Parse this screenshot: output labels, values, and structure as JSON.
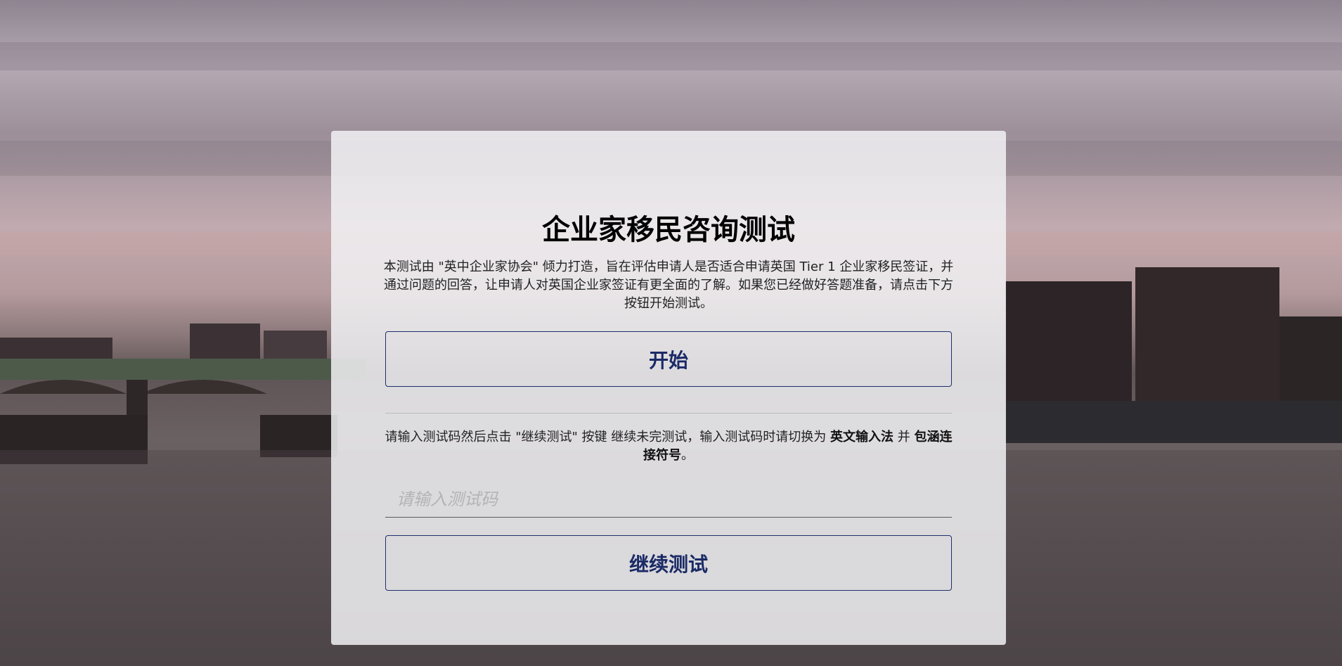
{
  "page": {
    "title": "企业家移民咨询测试",
    "intro": "本测试由 \"英中企业家协会\" 倾力打造，旨在评估申请人是否适合申请英国 Tier 1 企业家移民签证，并通过问题的回答，让申请人对英国企业家签证有更全面的了解。如果您已经做好答题准备，请点击下方按钮开始测试。",
    "start_label": "开始",
    "hint_prefix": "请输入测试码然后点击 \"继续测试\" 按键 继续未完测试，输入测试码时请切换为 ",
    "hint_bold1": "英文输入法",
    "hint_middle": " 并 ",
    "hint_bold2": "包涵连接符号",
    "hint_suffix": "。",
    "code_placeholder": "请输入测试码",
    "continue_label": "继续测试"
  },
  "background": {
    "description_icon": "london-westminster-skyline",
    "accent_color": "#1a2a66"
  }
}
